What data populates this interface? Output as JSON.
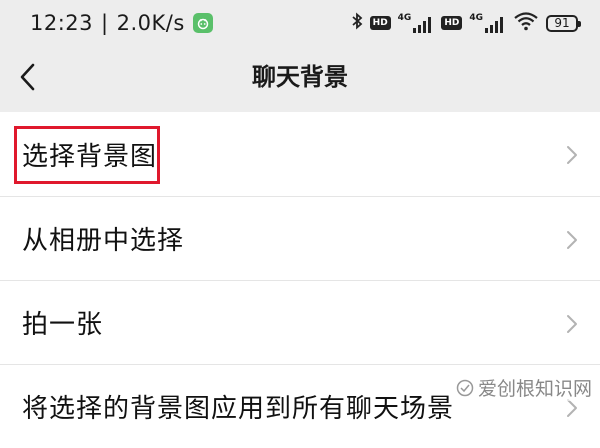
{
  "status_bar": {
    "time": "12:23",
    "separator": "|",
    "speed": "2.0K/s",
    "net_type_1": "4G",
    "net_type_2": "4G",
    "hd_1": "HD",
    "hd_2": "HD",
    "battery": "91"
  },
  "header": {
    "title": "聊天背景",
    "back_icon": "chevron-left-icon"
  },
  "list": {
    "items": [
      {
        "label": "选择背景图",
        "highlighted": true
      },
      {
        "label": "从相册中选择"
      },
      {
        "label": "拍一张"
      },
      {
        "label": "将选择的背景图应用到所有聊天场景"
      }
    ]
  },
  "watermark": {
    "text": "爱创根知识网"
  },
  "colors": {
    "highlight": "#e0182d",
    "background": "#ededed",
    "app_icon": "#5ac06a"
  }
}
